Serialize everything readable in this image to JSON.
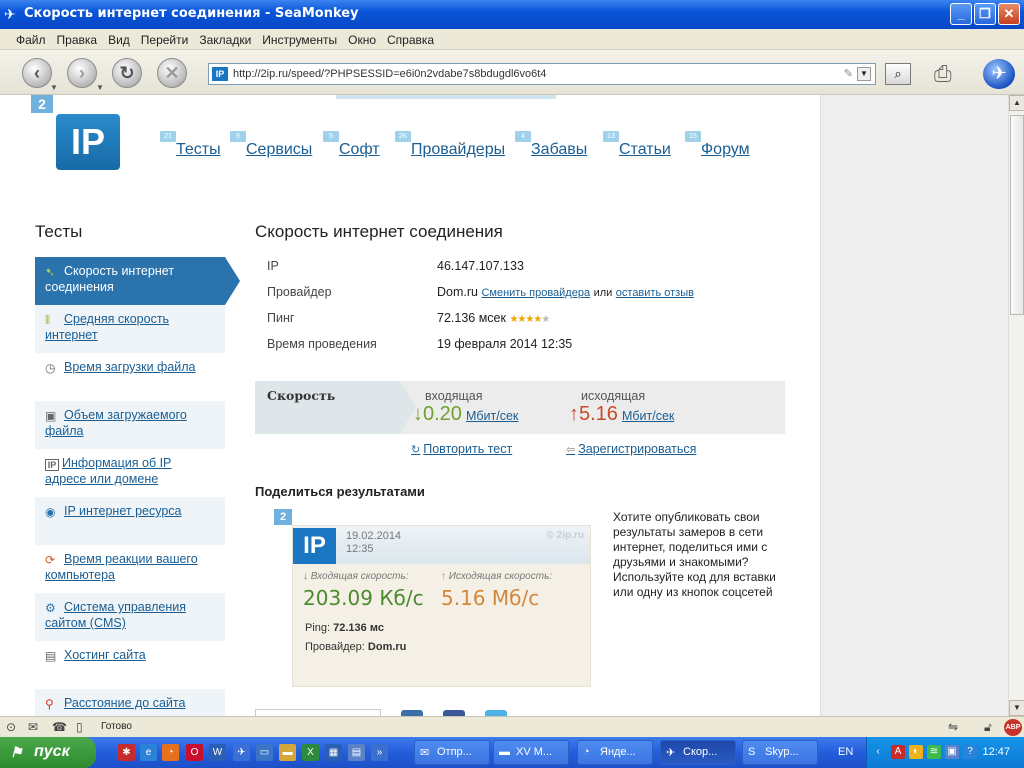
{
  "window": {
    "title": "Скорость интернет соединения - SeaMonkey"
  },
  "menu": [
    "Файл",
    "Правка",
    "Вид",
    "Перейти",
    "Закладки",
    "Инструменты",
    "Окно",
    "Справка"
  ],
  "address": {
    "url": "http://2ip.ru/speed/?PHPSESSID=e6i0n2vdabe7s8bdugdl6vo6t4",
    "site_icon": "IP"
  },
  "site": {
    "logo_badge": "2",
    "logo_text": "IP",
    "topnav": [
      {
        "badge": "21",
        "label": "Тесты"
      },
      {
        "badge": "9",
        "label": "Сервисы"
      },
      {
        "badge": "5",
        "label": "Софт"
      },
      {
        "badge": "2K",
        "label": "Провайдеры"
      },
      {
        "badge": "4",
        "label": "Забавы"
      },
      {
        "badge": "13",
        "label": "Статьи"
      },
      {
        "badge": "15",
        "label": "Форум"
      }
    ]
  },
  "sidebar": {
    "title": "Тесты",
    "items": [
      {
        "label": "Скорость интернет соединения",
        "icon": "speed-icon"
      },
      {
        "label": "Средняя скорость интернет",
        "icon": "bars-icon"
      },
      {
        "label": "Время загрузки файла",
        "icon": "clock-icon"
      },
      {
        "label": "Объем загружаемого файла",
        "icon": "box-icon"
      },
      {
        "label": "Информация об IP адресе или домене",
        "icon": "ip-icon"
      },
      {
        "label": "IP интернет ресурса",
        "icon": "globe-icon"
      },
      {
        "label": "Время реакции вашего компьютера",
        "icon": "reaction-icon"
      },
      {
        "label": "Система управления сайтом (CMS)",
        "icon": "gear-icon"
      },
      {
        "label": "Хостинг сайта",
        "icon": "server-icon"
      },
      {
        "label": "Расстояние до сайта",
        "icon": "pin-icon"
      }
    ]
  },
  "main": {
    "title": "Скорость интернет соединения",
    "info": {
      "ip_label": "IP",
      "ip_value": "46.147.107.133",
      "provider_label": "Провайдер",
      "provider_value": "Dom.ru",
      "provider_change": "Сменить провайдера",
      "provider_or": "или",
      "provider_review": "оставить отзыв",
      "ping_label": "Пинг",
      "ping_value": "72.136 мсек",
      "ping_rating": 4,
      "ping_rating_max": 5,
      "time_label": "Время проведения",
      "time_value": "19 февраля 2014 12:35"
    },
    "speed": {
      "label": "Скорость",
      "in_label": "входящая",
      "in_value": "0.20",
      "in_unit": "Мбит/сек",
      "out_label": "исходящая",
      "out_value": "5.16",
      "out_unit": "Мбит/сек"
    },
    "actions": {
      "retest": "Повторить тест",
      "register": "Зарегистрироваться"
    },
    "share": {
      "title": "Поделиться результатами",
      "badge": "2",
      "card_logo": "IP",
      "card_date": "19.02.2014",
      "card_time": "12:35",
      "card_brand": "© 2ip.ru",
      "dl_label": "Входящая скорость:",
      "dl_value": "203.09 Кб/с",
      "ul_label": "Исходящая скорость:",
      "ul_value": "5.16 Мб/с",
      "ping_label": "Ping:",
      "ping_value": "72.136 мс",
      "prov_label": "Провайдер:",
      "prov_value": "Dom.ru",
      "text": "Хотите опубликовать свои результаты замеров в сети интернет, поделиться ими с друзьями и знакомыми? Используйте код для вставки или одну из кнопок соцсетей"
    }
  },
  "status": {
    "text": "Готово"
  },
  "taskbar": {
    "start": "пуск",
    "tasks": [
      {
        "label": "Отпр...",
        "icon": "mail-window-icon"
      },
      {
        "label": "XV М...",
        "icon": "folder-icon"
      },
      {
        "label": "Янде...",
        "icon": "firefox-icon"
      },
      {
        "label": "Скор...",
        "icon": "seamonkey-icon",
        "active": true
      },
      {
        "label": "Skyp...",
        "icon": "skype-icon"
      }
    ],
    "lang": "EN",
    "clock": "12:47"
  },
  "colors": {
    "link": "#1a5e93",
    "active_sidebar": "#2b73ad",
    "speed_in": "#6fa22a",
    "speed_out": "#c94a2a"
  }
}
